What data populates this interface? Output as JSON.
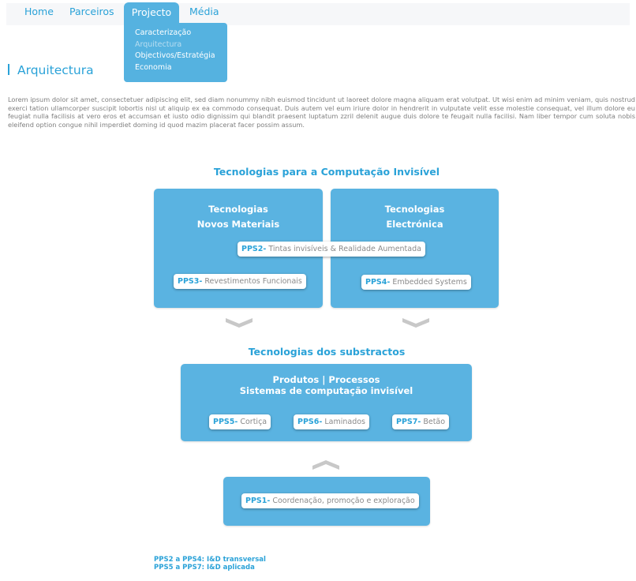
{
  "nav": {
    "items": [
      {
        "label": "Home"
      },
      {
        "label": "Parceiros"
      },
      {
        "label": "Projecto"
      },
      {
        "label": "Média"
      }
    ],
    "dropdown": [
      {
        "label": "Caracterização"
      },
      {
        "label": "Arquitectura"
      },
      {
        "label": "Objectivos/Estratégia"
      },
      {
        "label": "Economia"
      }
    ]
  },
  "page": {
    "title": "Arquitectura",
    "intro": "Lorem ipsum dolor sit amet, consectetuer adipiscing elit, sed diam nonummy nibh euismod tincidunt ut laoreet dolore magna aliquam erat volutpat. Ut wisi enim ad minim veniam, quis nostrud exerci tation ullamcorper suscipit lobortis nisl ut aliquip ex ea commodo consequat. Duis autem vel eum iriure dolor in hendrerit in vulputate velit esse molestie consequat, vel illum dolore eu feugiat nulla facilisis at vero eros et accumsan et iusto odio dignissim qui blandit praesent luptatum zzril delenit augue duis dolore te feugait nulla facilisi. Nam liber tempor cum soluta nobis eleifend option congue nihil imperdiet doming id quod mazim placerat facer possim assum."
  },
  "diagram": {
    "heading_top": "Tecnologias para a Computação Invisível",
    "left_box": {
      "line1": "Tecnologias",
      "line2": "Novos Materiais"
    },
    "right_box": {
      "line1": "Tecnologias",
      "line2": "Electrónica"
    },
    "pps2": {
      "code": "PPS2-",
      "text": " Tintas invisíveis & Realidade Aumentada"
    },
    "pps3": {
      "code": "PPS3-",
      "text": " Revestimentos Funcionais"
    },
    "pps4": {
      "code": "PPS4-",
      "text": " Embedded Systems"
    },
    "heading_bottom": "Tecnologias dos substractos",
    "subs_box": {
      "line1": "Produtos | Processos",
      "line2": "Sistemas de computação invisível"
    },
    "pps5": {
      "code": "PPS5-",
      "text": " Cortiça"
    },
    "pps6": {
      "code": "PPS6-",
      "text": " Laminados"
    },
    "pps7": {
      "code": "PPS7-",
      "text": " Betão"
    },
    "pps1": {
      "code": "PPS1-",
      "text": " Coordenação, promoção e exploração"
    }
  },
  "legend": {
    "line1": "PPS2 a PPS4: I&D transversal",
    "line2": "PPS5 a PPS7: I&D aplicada"
  },
  "colors": {
    "accent": "#2aa2d8",
    "box": "#5ab3e1",
    "chevron": "#c8c8c8"
  }
}
